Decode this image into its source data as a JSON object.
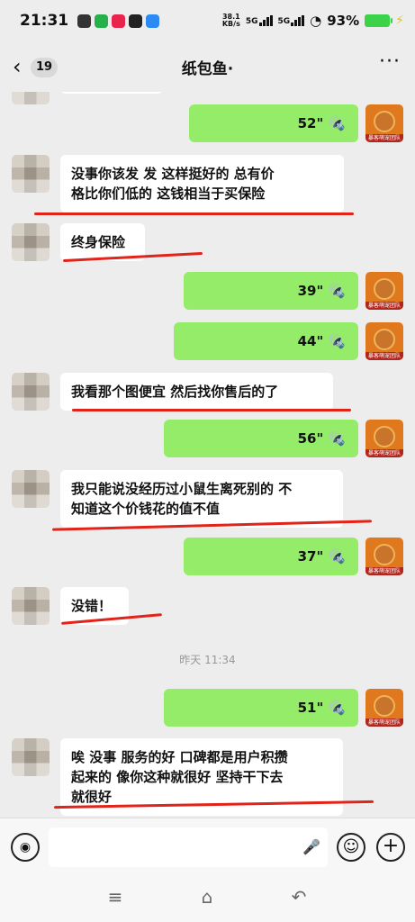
{
  "status_bar": {
    "time": "21:31",
    "net_speed_value": "38.1",
    "net_speed_unit": "KB/s",
    "signal_1": "5G",
    "signal_2": "5G",
    "battery": "93%"
  },
  "header": {
    "unread_count": "19",
    "title": "纸包鱼·"
  },
  "messages": [
    {
      "side": "right",
      "type": "voice",
      "duration": "52\""
    },
    {
      "side": "left",
      "type": "text",
      "lines": [
        "没事你该发  发   这样挺好的   总有价",
        "格比你们低的   这钱相当于买保险"
      ]
    },
    {
      "side": "left",
      "type": "text",
      "lines": [
        "终身保险"
      ]
    },
    {
      "side": "right",
      "type": "voice",
      "duration": "39\""
    },
    {
      "side": "right",
      "type": "voice",
      "duration": "44\""
    },
    {
      "side": "left",
      "type": "text",
      "lines": [
        "我看那个图便宜  然后找你售后的了"
      ]
    },
    {
      "side": "right",
      "type": "voice",
      "duration": "56\""
    },
    {
      "side": "left",
      "type": "text",
      "lines": [
        "我只能说没经历过小鼠生离死别的  不",
        "知道这个价钱花的值不值"
      ]
    },
    {
      "side": "right",
      "type": "voice",
      "duration": "37\""
    },
    {
      "side": "left",
      "type": "text",
      "lines": [
        "没错！"
      ]
    },
    {
      "type": "timestamp",
      "text": "昨天 11:34"
    },
    {
      "side": "right",
      "type": "voice",
      "duration": "51\""
    },
    {
      "side": "left",
      "type": "text",
      "lines": [
        "唉  没事  服务的好  口碑都是用户积攒",
        "起来的   像你这种就很好  坚持干下去",
        "就很好"
      ]
    }
  ],
  "avatar_right_tag": "暴客萌宠团队",
  "colors": {
    "sent_bubble": "#95ec69",
    "received_bubble": "#ffffff",
    "background": "#ededed",
    "annotation": "#e2231a"
  },
  "icons": {
    "back": "chevron-left-icon",
    "more": "more-dots-icon",
    "voice": "voice-wave-icon",
    "voice_toggle": "voice-input-icon",
    "mic": "mic-icon",
    "emoji": "emoji-icon",
    "plus": "plus-icon"
  }
}
